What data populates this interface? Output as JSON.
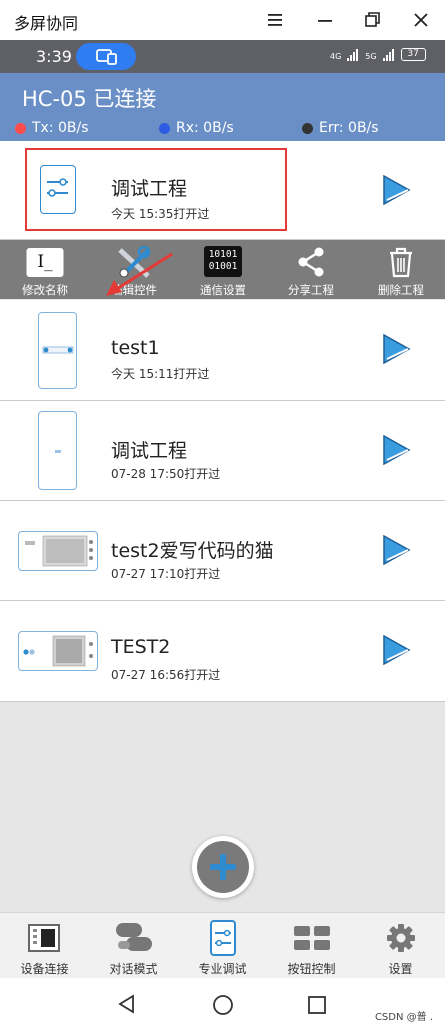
{
  "window": {
    "title": "多屏协同",
    "minimize_icon": "minimize-icon",
    "restore_icon": "restore-icon",
    "close_icon": "close-icon",
    "menu_icon": "menu-icon"
  },
  "status_bar": {
    "time": "3:39",
    "signal_1": "4G",
    "signal_2": "5G",
    "battery": "37"
  },
  "device": {
    "name": "HC-05 已连接",
    "tx": "Tx: 0B/s",
    "rx": "Rx: 0B/s",
    "err": "Err: 0B/s",
    "tx_color": "#ff4d4d",
    "rx_color": "#2d5be3",
    "err_color": "#333333"
  },
  "projects": [
    {
      "name": "调试工程",
      "time": "今天 15:35打开过"
    },
    {
      "name": "test1",
      "time": "今天 15:11打开过"
    },
    {
      "name": "调试工程",
      "time": "07-28 17:50打开过"
    },
    {
      "name": "test2爱写代码的猫",
      "time": "07-27 17:10打开过"
    },
    {
      "name": "TEST2",
      "time": "07-27 16:56打开过"
    }
  ],
  "toolbar": {
    "rename": "修改名称",
    "edit": "编辑控件",
    "comm": "通信设置",
    "share": "分享工程",
    "delete": "删除工程",
    "binary_top": "10101",
    "binary_bottom": "01001",
    "cursor_text": "I_"
  },
  "bottom_nav": {
    "device": "设备连接",
    "chat": "对话模式",
    "pro": "专业调试",
    "button": "按钮控制",
    "settings": "设置"
  },
  "watermark": "CSDN @普 ."
}
